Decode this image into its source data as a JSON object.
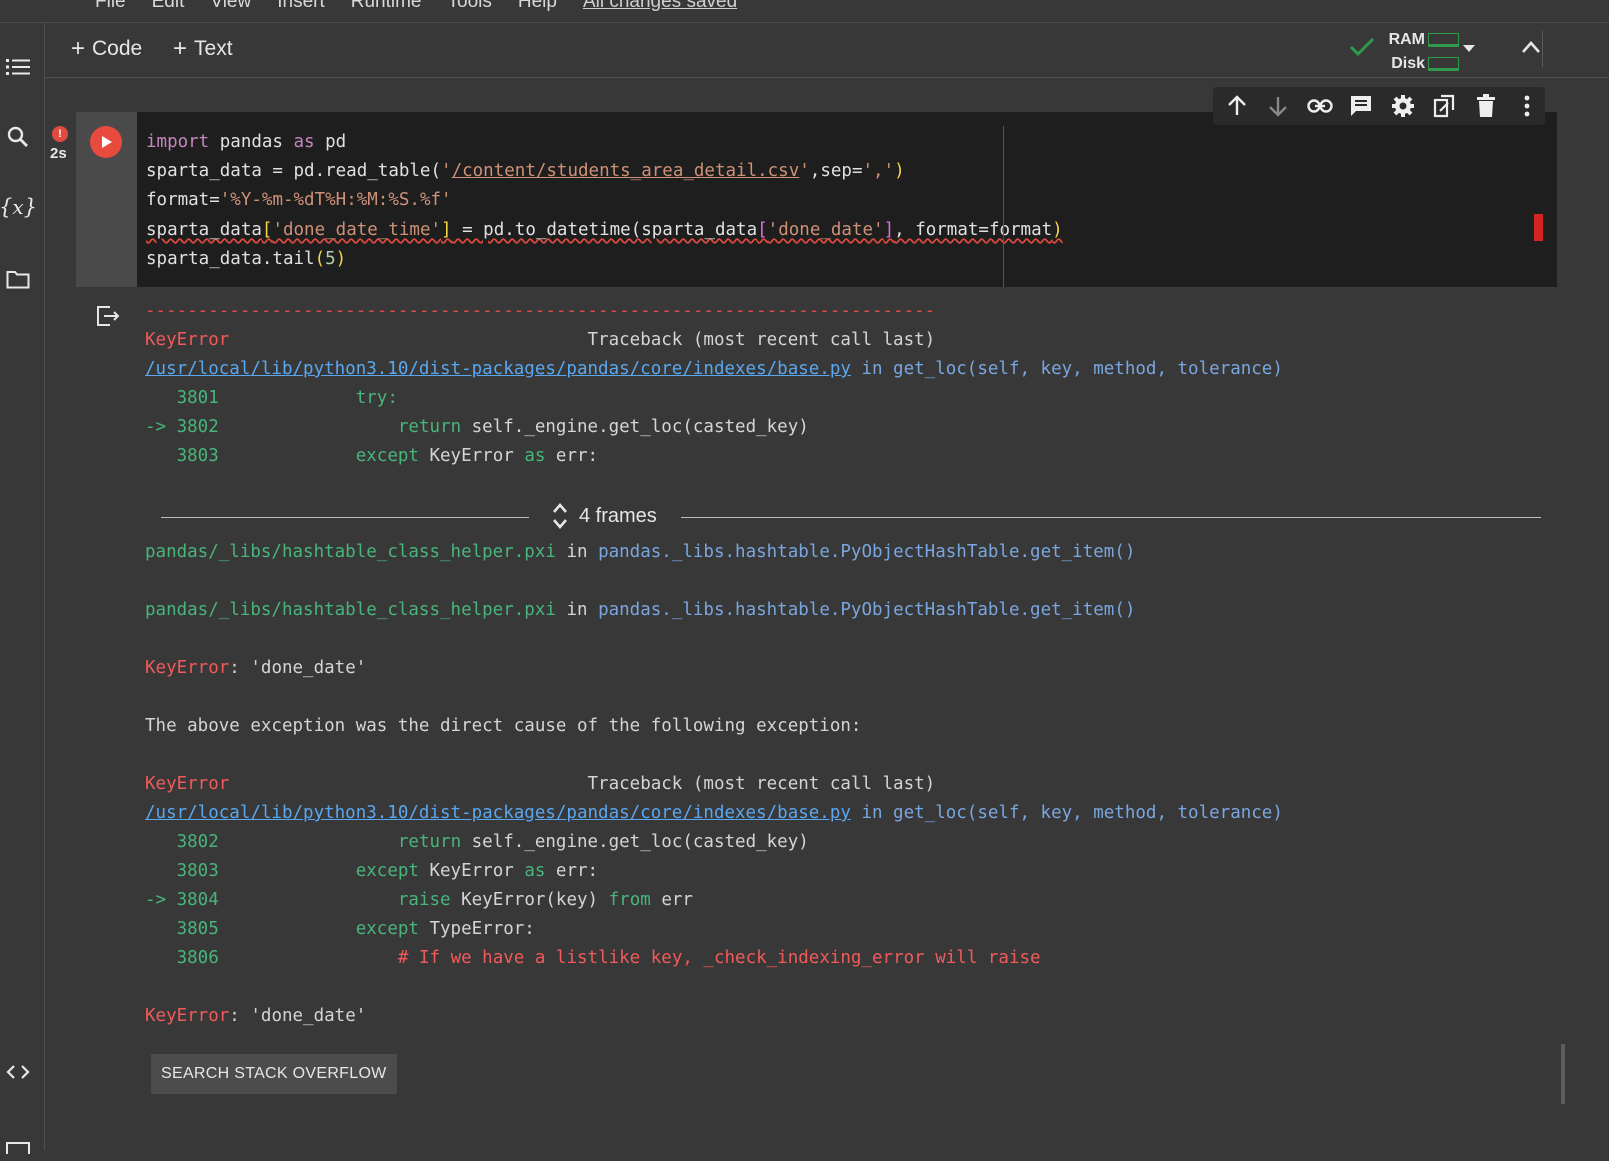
{
  "menubar": {
    "items": [
      "File",
      "Edit",
      "View",
      "Insert",
      "Runtime",
      "Tools",
      "Help"
    ],
    "save_status": "All changes saved"
  },
  "toolbar": {
    "code_label": "Code",
    "text_label": "Text"
  },
  "resources": {
    "ram_label": "RAM",
    "disk_label": "Disk",
    "status_color": "#2e9a4b"
  },
  "cell": {
    "exec_time": "2s",
    "error_badge": "!"
  },
  "frames_label": "4 frames",
  "search_button": "SEARCH STACK OVERFLOW",
  "colors": {
    "error": "#f25a5a",
    "link": "#5aa7f0",
    "lineno": "#48b57a",
    "run_button": "#e84a3e"
  },
  "code": {
    "l1": {
      "a": "import",
      "b": " pandas ",
      "c": "as",
      "d": " pd"
    },
    "l2": {
      "a": "sparta_data = pd.read_table(",
      "b": "'",
      "c": "/content/students_area_detail.csv",
      "d": "'",
      "e": ",sep=",
      "f": "','",
      "g": ")"
    },
    "l3": {
      "a": "format=",
      "b": "'%Y-%m-%dT%H:%M:%S.%f'"
    },
    "l4": {
      "a": "sparta_data",
      "b": "[",
      "c": "'done_date_time'",
      "d": "]",
      "e": " = pd.to_datetime(sparta_data",
      "f": "[",
      "g": "'done_date'",
      "h": "]",
      "i": ", format=format",
      "j": ")"
    },
    "l5": {
      "a": "sparta_data.tail",
      "b": "(",
      "c": "5",
      "d": ")"
    }
  },
  "traceback": {
    "dashes": "---------------------------------------------------------------------------",
    "err_name": "KeyError",
    "tb_header": "                                  Traceback (most recent call last)",
    "file_link": "/usr/local/lib/python3.10/dist-packages/pandas/core/indexes/base.py",
    "in_sig": " in get_loc(self, key, method, tolerance)",
    "b1": {
      "r1": {
        "num": "   3801",
        "code": "             try:"
      },
      "r2": {
        "arrow": "-> ",
        "num": "3802",
        "ind": "                 ",
        "kw": "return",
        "code": " self._engine.get_loc(casted_key)"
      },
      "r3": {
        "num": "   3803",
        "ind": "             ",
        "kw": "except",
        "code": " KeyError ",
        "kw2": "as",
        "code2": " err:"
      }
    },
    "pxi_file": "pandas/_libs/hashtable_class_helper.pxi",
    "pxi_in": " in ",
    "pxi_func": "pandas._libs.hashtable.PyObjectHashTable.get_item()",
    "key_msg": ": 'done_date'",
    "cause": "The above exception was the direct cause of the following exception:",
    "b2": {
      "r1": {
        "num": "   3802",
        "ind": "                 ",
        "kw": "return",
        "code": " self._engine.get_loc(casted_key)"
      },
      "r2": {
        "num": "   3803",
        "ind": "             ",
        "kw": "except",
        "code": " KeyError ",
        "kw2": "as",
        "code2": " err:"
      },
      "r3": {
        "arrow": "-> ",
        "num": "3804",
        "ind": "                 ",
        "kw": "raise",
        "code": " KeyError(key) ",
        "kw2": "from",
        "code2": " err"
      },
      "r4": {
        "num": "   3805",
        "ind": "             ",
        "kw": "except",
        "code": " TypeError:"
      },
      "r5": {
        "num": "   3806",
        "ind": "                 ",
        "comment": "# If we have a listlike key, _check_indexing_error will raise"
      }
    }
  }
}
